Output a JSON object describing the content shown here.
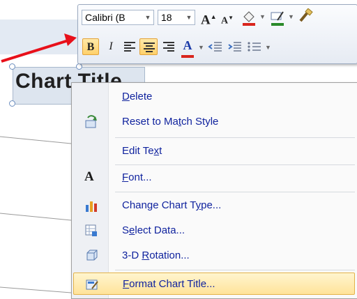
{
  "chart": {
    "title": "Chart Title"
  },
  "toolbar": {
    "font_name": "Calibri (B",
    "font_size": "18",
    "grow_font": "A",
    "shrink_font": "A",
    "bold": "B",
    "italic": "I"
  },
  "menu": {
    "items": [
      {
        "pre": "",
        "acc": "D",
        "post": "elete",
        "icon": "none"
      },
      {
        "pre": "Reset to Ma",
        "acc": "t",
        "post": "ch Style",
        "icon": "reset-style-icon"
      },
      {
        "pre": "Edit Te",
        "acc": "x",
        "post": "t",
        "icon": "none"
      },
      {
        "pre": "",
        "acc": "F",
        "post": "ont...",
        "icon": "font-icon"
      },
      {
        "pre": "Change Chart T",
        "acc": "y",
        "post": "pe...",
        "icon": "chart-type-icon"
      },
      {
        "pre": "S",
        "acc": "e",
        "post": "lect Data...",
        "icon": "select-data-icon"
      },
      {
        "pre": "3-D ",
        "acc": "R",
        "post": "otation...",
        "icon": "rotation-3d-icon"
      },
      {
        "pre": "",
        "acc": "F",
        "post": "ormat Chart Title...",
        "icon": "format-title-icon"
      }
    ]
  },
  "colors": {
    "highlight": "#ffe39a",
    "arrow": "#e8101a",
    "menu_text": "#10239e"
  }
}
